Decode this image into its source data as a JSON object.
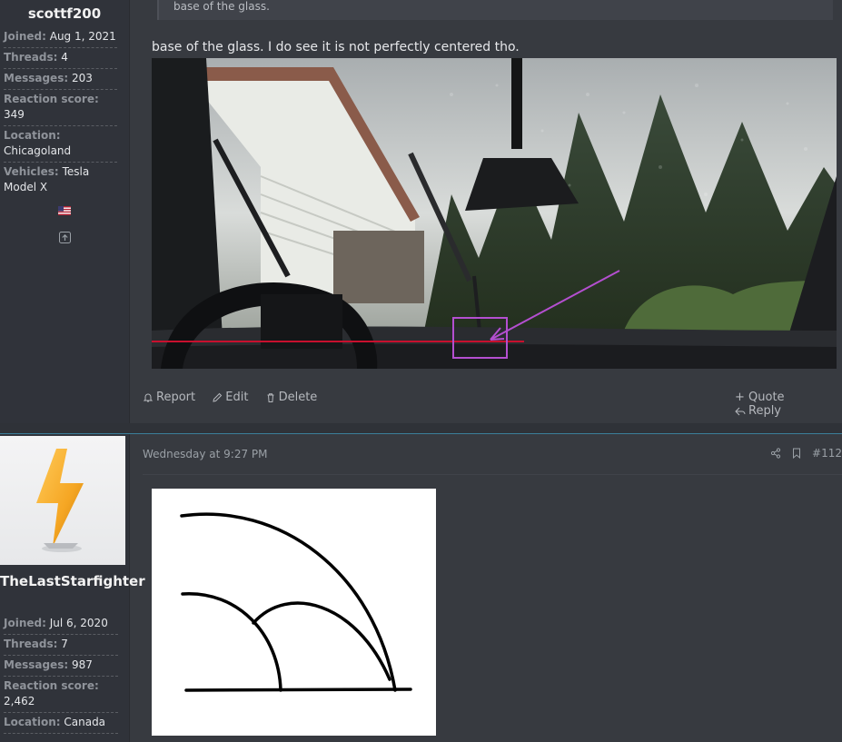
{
  "posts": [
    {
      "author": {
        "username": "scottf200",
        "stats": [
          {
            "key": "Joined:",
            "value": "Aug 1, 2021"
          },
          {
            "key": "Threads:",
            "value": "4"
          },
          {
            "key": "Messages:",
            "value": "203"
          },
          {
            "key": "Reaction score:",
            "value": "349"
          },
          {
            "key": "Location:",
            "value": "Chicagoland"
          },
          {
            "key": "Vehicles:",
            "value": "Tesla Model X"
          }
        ],
        "flag_icon": "us-flag-icon",
        "expand_icon": "expand-up-icon"
      },
      "quote_text": "base of the glass.",
      "body_text": "base of the glass. I do see it is not perfectly centered tho.",
      "actions": {
        "report": "Report",
        "edit": "Edit",
        "delete": "Delete",
        "quote": "+ Quote",
        "reply": "Reply"
      }
    },
    {
      "author": {
        "username": "TheLastStarfighter",
        "stats": [
          {
            "key": "Joined:",
            "value": "Jul 6, 2020"
          },
          {
            "key": "Threads:",
            "value": "7"
          },
          {
            "key": "Messages:",
            "value": "987"
          },
          {
            "key": "Reaction score:",
            "value": "2,462"
          },
          {
            "key": "Location:",
            "value": "Canada"
          }
        ]
      },
      "date": "Wednesday at 9:27 PM",
      "post_number": "#112"
    }
  ],
  "colors": {
    "accent": "#3b7f9a",
    "annotation_red": "#c8102e",
    "annotation_purple": "#b44fd0"
  }
}
